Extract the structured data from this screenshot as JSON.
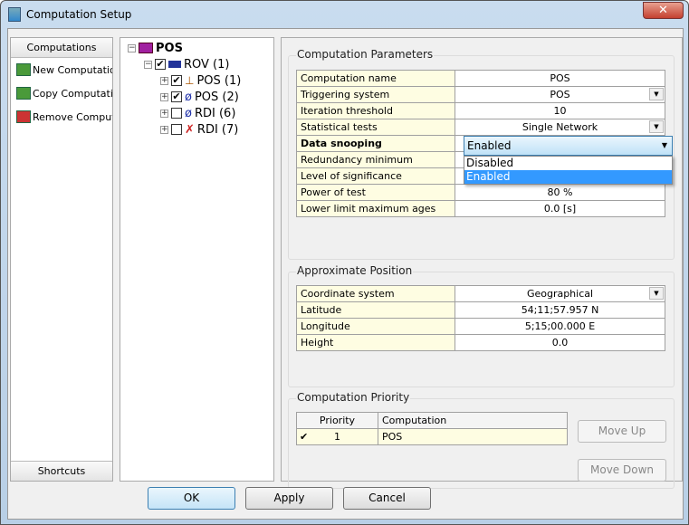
{
  "window": {
    "title": "Computation Setup",
    "close": "✕"
  },
  "left": {
    "header": "Computations",
    "items": [
      "New Computation",
      "Copy Computation",
      "Remove Computation"
    ],
    "footer": "Shortcuts"
  },
  "tree": {
    "root": "POS",
    "child": "ROV (1)",
    "items": [
      {
        "label": "POS (1)",
        "checked": true
      },
      {
        "label": "POS (2)",
        "checked": true
      },
      {
        "label": "RDI (6)",
        "checked": false
      },
      {
        "label": "RDI (7)",
        "checked": false
      }
    ]
  },
  "params": {
    "title": "Computation Parameters",
    "rows": [
      {
        "label": "Computation name",
        "value": "POS"
      },
      {
        "label": "Triggering system",
        "value": "POS",
        "dropdown": true
      },
      {
        "label": "Iteration threshold",
        "value": "10"
      },
      {
        "label": "Statistical tests",
        "value": "Single Network",
        "dropdown": true
      },
      {
        "label": "Data snooping",
        "value": "Enabled"
      },
      {
        "label": "Redundancy minimum",
        "value": ""
      },
      {
        "label": "Level of significance",
        "value": ""
      },
      {
        "label": "Power of test",
        "value": "80 %"
      },
      {
        "label": "Lower limit maximum ages",
        "value": "0.0 [s]"
      }
    ],
    "dropdown_options": [
      "Disabled",
      "Enabled"
    ],
    "dropdown_selected": "Enabled"
  },
  "position": {
    "title": "Approximate Position",
    "rows": [
      {
        "label": "Coordinate system",
        "value": "Geographical"
      },
      {
        "label": "Latitude",
        "value": "54;11;57.957 N"
      },
      {
        "label": "Longitude",
        "value": "5;15;00.000 E"
      },
      {
        "label": "Height",
        "value": "0.0"
      }
    ]
  },
  "priority": {
    "title": "Computation Priority",
    "headers": [
      "Priority",
      "Computation"
    ],
    "rows": [
      {
        "checked": "✔",
        "priority": "1",
        "computation": "POS"
      }
    ],
    "move_up": "Move Up",
    "move_down": "Move Down"
  },
  "buttons": {
    "ok": "OK",
    "apply": "Apply",
    "cancel": "Cancel"
  }
}
